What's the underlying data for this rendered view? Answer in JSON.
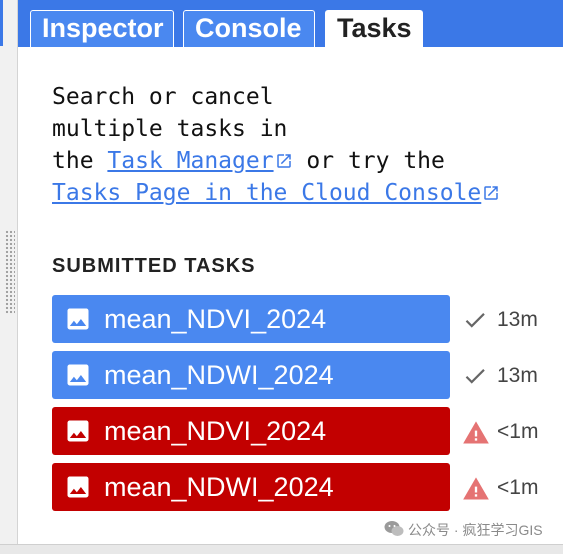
{
  "tabs": {
    "inspector": "Inspector",
    "console": "Console",
    "tasks": "Tasks"
  },
  "intro": {
    "line1": "Search or cancel",
    "line2": "multiple tasks in",
    "the": "the ",
    "task_manager_link": "Task Manager",
    "or_try_the": " or try the",
    "tasks_page_link": "Tasks Page in the Cloud Console"
  },
  "section_title": "SUBMITTED TASKS",
  "tasks": [
    {
      "name": "mean_NDVI_2024",
      "status": "completed",
      "status_icon": "check-icon",
      "duration": "13m",
      "color": "#4a88f0"
    },
    {
      "name": "mean_NDWI_2024",
      "status": "completed",
      "status_icon": "check-icon",
      "duration": "13m",
      "color": "#4a88f0"
    },
    {
      "name": "mean_NDVI_2024",
      "status": "failed",
      "status_icon": "warning-icon",
      "duration": "<1m",
      "color": "#c20000"
    },
    {
      "name": "mean_NDWI_2024",
      "status": "failed",
      "status_icon": "warning-icon",
      "duration": "<1m",
      "color": "#c20000"
    }
  ],
  "watermark": "公众号 · 疯狂学习GIS",
  "colors": {
    "accent": "#3b78e7",
    "task_ok": "#4a88f0",
    "task_failed": "#c20000",
    "warning": "#e57373"
  }
}
